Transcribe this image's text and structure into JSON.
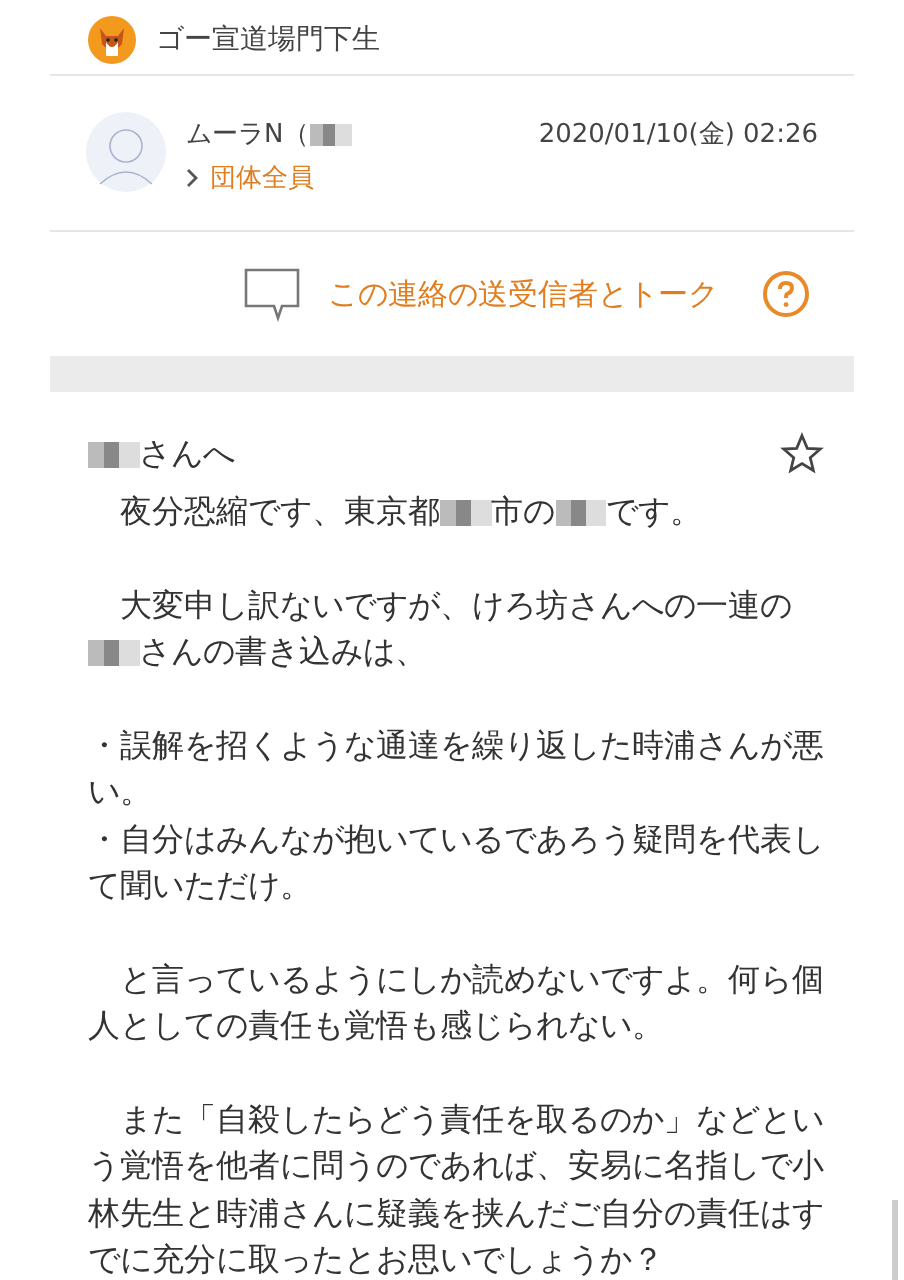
{
  "group": {
    "name": "ゴー宣道場門下生"
  },
  "post": {
    "author": [
      {
        "kind": "text",
        "text": "ムーラN（"
      },
      {
        "kind": "redaction"
      }
    ],
    "date": "2020/01/10(金) 02:26",
    "recipients": "団体全員",
    "talk_link": "この連絡の送受信者とトーク",
    "starred": false,
    "salutation": [
      {
        "kind": "redaction"
      },
      {
        "kind": "text",
        "text": "さんへ"
      }
    ],
    "paragraphs": [
      [
        {
          "kind": "text",
          "text": "　夜分恐縮です、東京都"
        },
        {
          "kind": "redaction"
        },
        {
          "kind": "text",
          "text": "市の"
        },
        {
          "kind": "redaction"
        },
        {
          "kind": "text",
          "text": "です。"
        }
      ],
      [
        {
          "kind": "text",
          "text": "　大変申し訳ないですが、けろ坊さんへの一連の"
        },
        {
          "kind": "redaction"
        },
        {
          "kind": "text",
          "text": "さんの書き込みは、"
        }
      ],
      [
        {
          "kind": "text",
          "text": "・誤解を招くような通達を繰り返した時浦さんが悪い。"
        },
        {
          "kind": "break"
        },
        {
          "kind": "text",
          "text": "・自分はみんなが抱いているであろう疑問を代表して聞いただけ。"
        }
      ],
      [
        {
          "kind": "text",
          "text": "　と言っているようにしか読めないですよ。何ら個人としての責任も覚悟も感じられない。"
        }
      ],
      [
        {
          "kind": "text",
          "text": "　また「自殺したらどう責任を取るのか」などという覚悟を他者に問うのであれば、安易に名指しで小林先生と時浦さんに疑義を挟んだご自分の責任はすでに充分に取ったとお思いでしょうか？"
        }
      ]
    ]
  }
}
